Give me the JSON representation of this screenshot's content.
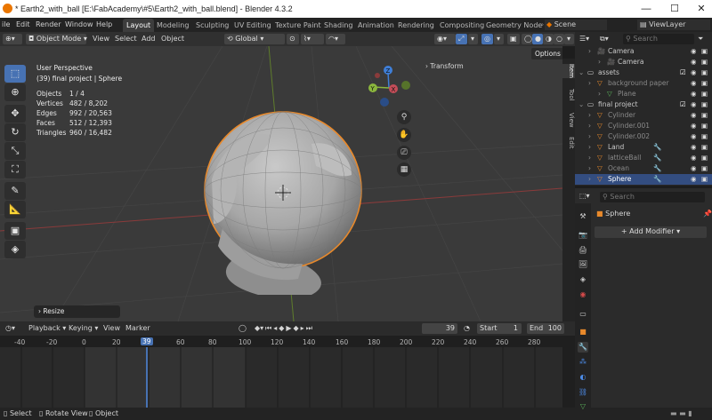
{
  "window": {
    "title": "* Earth2_with_ball [E:\\FabAcademy\\#5\\Earth2_with_ball.blend] - Blender 4.3.2",
    "minimize": "—",
    "maximize": "☐",
    "close": "✕"
  },
  "menubar": {
    "items": [
      "ile",
      "Edit",
      "Render",
      "Window",
      "Help"
    ],
    "workspaces": [
      "Layout",
      "Modeling",
      "Sculpting",
      "UV Editing",
      "Texture Paint",
      "Shading",
      "Animation",
      "Rendering",
      "Compositing",
      "Geometry Node"
    ],
    "active_workspace": "Layout",
    "scene": "Scene",
    "view_layer": "ViewLayer"
  },
  "viewport_header": {
    "mode": "Object Mode",
    "menus": [
      "View",
      "Select",
      "Add",
      "Object"
    ],
    "transform_orientation": "Global",
    "options": "Options"
  },
  "viewport": {
    "perspective": "User Perspective",
    "context": "(39) final project | Sphere",
    "stats": [
      {
        "label": "Objects",
        "value": "1 / 4"
      },
      {
        "label": "Vertices",
        "value": "482 / 8,202"
      },
      {
        "label": "Edges",
        "value": "992 / 20,563"
      },
      {
        "label": "Faces",
        "value": "512 / 12,393"
      },
      {
        "label": "Triangles",
        "value": "960 / 16,482"
      }
    ],
    "transform_panel": "Transform",
    "last_op": "Resize",
    "gizmo": {
      "x": "X",
      "y": "Y",
      "z": "Z"
    }
  },
  "sidetabs": [
    "Item",
    "Tool",
    "View",
    "Edit"
  ],
  "timeline": {
    "menus": [
      "Playback",
      "Keying",
      "View",
      "Marker"
    ],
    "current_frame": "39",
    "start_label": "Start",
    "start": "1",
    "end_label": "End",
    "end": "100",
    "frames": [
      "-40",
      "-20",
      "0",
      "20",
      "39",
      "60",
      "80",
      "100",
      "120",
      "140",
      "160",
      "180",
      "200",
      "220",
      "240",
      "260",
      "280"
    ]
  },
  "statusbar": {
    "select": "Select",
    "rotate": "Rotate View",
    "object": "Object"
  },
  "outliner": {
    "search_placeholder": "Search",
    "rows": [
      {
        "name": "Camera",
        "depth": 2,
        "sel": false,
        "kind": "cam"
      },
      {
        "name": "Camera",
        "depth": 3,
        "sel": false,
        "kind": "camdata"
      },
      {
        "name": "assets",
        "depth": 1,
        "sel": false,
        "kind": "coll"
      },
      {
        "name": "background paper",
        "depth": 2,
        "sel": false,
        "kind": "obj",
        "dim": true
      },
      {
        "name": "Plane",
        "depth": 3,
        "sel": false,
        "kind": "mesh",
        "dim": true
      },
      {
        "name": "final project",
        "depth": 1,
        "sel": false,
        "kind": "coll"
      },
      {
        "name": "Cylinder",
        "depth": 2,
        "sel": false,
        "kind": "obj",
        "dim": true
      },
      {
        "name": "Cylinder.001",
        "depth": 2,
        "sel": false,
        "kind": "obj",
        "dim": true
      },
      {
        "name": "Cylinder.002",
        "depth": 2,
        "sel": false,
        "kind": "obj",
        "dim": true
      },
      {
        "name": "Land",
        "depth": 2,
        "sel": false,
        "kind": "obj"
      },
      {
        "name": "latticeBall",
        "depth": 2,
        "sel": false,
        "kind": "obj",
        "dim": true
      },
      {
        "name": "Ocean",
        "depth": 2,
        "sel": false,
        "kind": "obj",
        "dim": true
      },
      {
        "name": "Sphere",
        "depth": 2,
        "sel": true,
        "kind": "obj"
      }
    ]
  },
  "properties": {
    "search_placeholder": "Search",
    "object_name": "Sphere",
    "add_modifier": "Add Modifier"
  },
  "colors": {
    "accent": "#4772b3",
    "orange": "#e8892b",
    "x_axis": "#c44d58",
    "y_axis": "#8bb63d",
    "z_axis": "#3f7fd8"
  }
}
